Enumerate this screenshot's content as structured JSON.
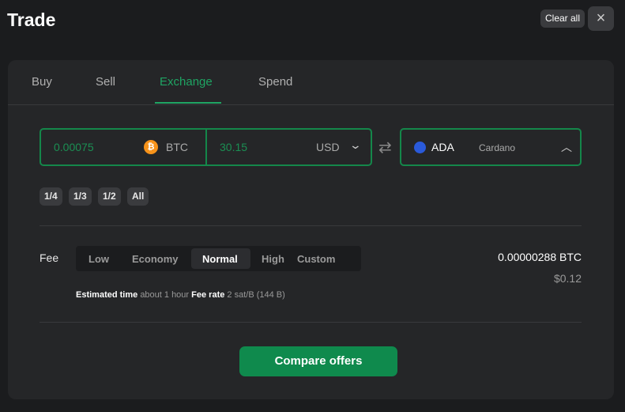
{
  "header": {
    "title": "Trade",
    "clear_all": "Clear all",
    "close_icon": "×"
  },
  "tabs": [
    "Buy",
    "Sell",
    "Exchange",
    "Spend"
  ],
  "active_tab": "Exchange",
  "from": {
    "amount": "0.00075",
    "currency": "BTC",
    "fiat_amount": "30.15",
    "fiat_currency": "USD"
  },
  "to": {
    "symbol": "ADA",
    "name": "Cardano"
  },
  "swap_icon": "⇄",
  "fractions": [
    "1/4",
    "1/3",
    "1/2",
    "All"
  ],
  "fee": {
    "label": "Fee",
    "options": [
      "Low",
      "Economy",
      "Normal",
      "High",
      "Custom"
    ],
    "selected": "Normal",
    "amount_btc": "0.00000288 BTC",
    "amount_usd": "$0.12",
    "est_time_label": "Estimated time",
    "est_time": "about 1 hour",
    "rate_label": "Fee rate",
    "rate": "2 sat/B",
    "size": "(144 B)"
  },
  "compare_button": "Compare offers",
  "colors": {
    "accent": "#1fa463",
    "button": "#0f8a4d",
    "btc": "#f7931a",
    "ada": "#2a5ada"
  }
}
